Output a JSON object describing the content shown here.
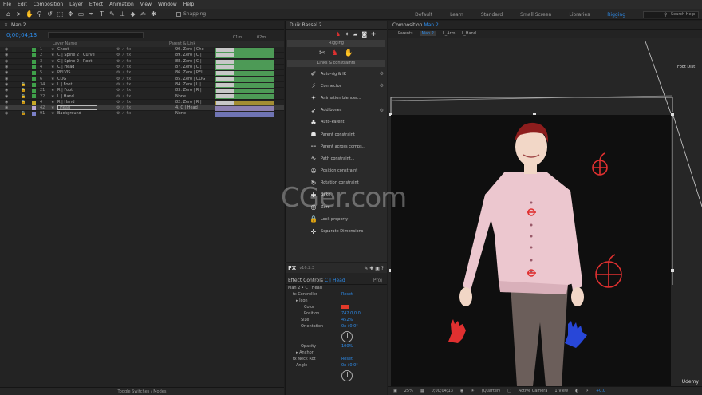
{
  "menu": [
    "File",
    "Edit",
    "Composition",
    "Layer",
    "Effect",
    "Animation",
    "View",
    "Window",
    "Help"
  ],
  "toolbar": {
    "snapping_label": "Snapping",
    "workspaces": [
      "Default",
      "Learn",
      "Standard",
      "Small Screen",
      "Libraries",
      "Rigging"
    ],
    "active_workspace": "Rigging",
    "search_placeholder": "Search Help"
  },
  "timeline": {
    "tab_label": "Man 2",
    "timecode": "0;00;04;13",
    "col_layer_name": "Layer Name",
    "col_parent": "Parent & Link",
    "ruler_labels": [
      "01m",
      "02m"
    ],
    "footer_label": "Toggle Switches / Modes",
    "layers": [
      {
        "num": "1",
        "name": "Chest",
        "parent": "90. Zero | Che",
        "color": "#3fa04a",
        "locked": false
      },
      {
        "num": "2",
        "name": "C | Spine 2 | Curve",
        "parent": "89. Zero | C | ",
        "color": "#3fa04a",
        "locked": false
      },
      {
        "num": "3",
        "name": "C | Spine 2 | Root",
        "parent": "88. Zero | C | ",
        "color": "#3fa04a",
        "locked": false
      },
      {
        "num": "4",
        "name": "C | Head",
        "parent": "87. Zero | C | ",
        "color": "#3fa04a",
        "locked": false
      },
      {
        "num": "5",
        "name": "PELVIS",
        "parent": "86. Zero | PEL",
        "color": "#3fa04a",
        "locked": false
      },
      {
        "num": "6",
        "name": "COG",
        "parent": "85. Zero | COG",
        "color": "#3fa04a",
        "locked": false
      },
      {
        "num": "34",
        "name": "L | Foot",
        "parent": "84. Zero | L | ",
        "color": "#3fa04a",
        "locked": true
      },
      {
        "num": "21",
        "name": "R | Foot",
        "parent": "83. Zero | R | ",
        "color": "#3fa04a",
        "locked": true
      },
      {
        "num": "22",
        "name": "L | Hand",
        "parent": "None",
        "color": "#3fa04a",
        "locked": true
      },
      {
        "num": "4",
        "name": "R | Hand",
        "parent": "82. Zero | R | ",
        "color": "#c7a928",
        "locked": true
      },
      {
        "num": "42",
        "name": "Head",
        "parent": "4. C | Head",
        "color": "#b8a7d4",
        "locked": false
      },
      {
        "num": "91",
        "name": "Background",
        "parent": "None",
        "color": "#7b80c8",
        "locked": true
      }
    ]
  },
  "duik": {
    "tab_label": "Duik Bassel.2",
    "section_rigging": "Rigging",
    "section_links": "Links & constraints",
    "items": [
      {
        "icon": "✐",
        "label": "Auto-rig & IK",
        "gear": true,
        "name": "auto-rig-ik"
      },
      {
        "icon": "⚡",
        "label": "Connector",
        "gear": true,
        "name": "connector"
      },
      {
        "icon": "✦",
        "label": "Animation blender...",
        "gear": false,
        "name": "animation-blender"
      },
      {
        "icon": "➶",
        "label": "Add bones",
        "gear": true,
        "name": "add-bones"
      },
      {
        "icon": "♣",
        "label": "Auto-Parent",
        "gear": false,
        "name": "auto-parent"
      },
      {
        "icon": "☗",
        "label": "Parent constraint",
        "gear": false,
        "name": "parent-constraint"
      },
      {
        "icon": "☷",
        "label": "Parent across comps...",
        "gear": false,
        "name": "parent-across-comps"
      },
      {
        "icon": "∿",
        "label": "Path constraint...",
        "gear": false,
        "name": "path-constraint"
      },
      {
        "icon": "✇",
        "label": "Position constraint",
        "gear": false,
        "name": "position-constraint"
      },
      {
        "icon": "↻",
        "label": "Rotation constraint",
        "gear": false,
        "name": "rotation-constraint"
      },
      {
        "icon": "✚",
        "label": "Bake",
        "gear": false,
        "name": "bake"
      },
      {
        "icon": "◎",
        "label": "Zero",
        "gear": false,
        "name": "zero"
      },
      {
        "icon": "🔒",
        "label": "Lock property",
        "gear": false,
        "name": "lock-property"
      },
      {
        "icon": "✜",
        "label": "Separate Dimensions",
        "gear": false,
        "name": "separate-dimensions"
      }
    ]
  },
  "effects": {
    "version": "v16.2.3",
    "tab_label": "Effect Controls",
    "tab_layer": "C | Head",
    "second_tab": "Proj",
    "breadcrumb": "Man 2 • C | Head",
    "rows": [
      {
        "indent": 6,
        "label": "Controller",
        "reset": "Reset",
        "kind": "fx"
      },
      {
        "indent": 10,
        "label": "Icon",
        "kind": "group"
      },
      {
        "indent": 20,
        "label": "Color",
        "kind": "color"
      },
      {
        "indent": 20,
        "label": "Position",
        "value": "742.0,0.0",
        "kind": "value"
      },
      {
        "indent": 16,
        "label": "Size",
        "value": "452%",
        "kind": "value"
      },
      {
        "indent": 16,
        "label": "Orientation",
        "value": "0x+0.0°",
        "kind": "value"
      },
      {
        "indent": 0,
        "label": "",
        "kind": "knob"
      },
      {
        "indent": 16,
        "label": "Opacity",
        "value": "100%",
        "kind": "value"
      },
      {
        "indent": 10,
        "label": "Anchor",
        "kind": "group"
      },
      {
        "indent": 6,
        "label": "Neck Rot",
        "reset": "Reset",
        "kind": "fx"
      },
      {
        "indent": 10,
        "label": "Angle",
        "value": "0x+0.0°",
        "kind": "value"
      },
      {
        "indent": 0,
        "label": "",
        "kind": "knob"
      }
    ]
  },
  "comp": {
    "tab_prefix": "Composition",
    "tab_name": "Man 2",
    "crumbs": [
      "Man 2",
      "L_Arm",
      "L_Hand"
    ],
    "crumbs_label": "Parents",
    "foot_label": "Foot Dist",
    "footer": {
      "zoom": "25%",
      "timecode": "0;00;04;13",
      "resolution": "(Quarter)",
      "camera": "Active Camera",
      "views": "1 View",
      "exposure": "+0.0"
    }
  },
  "overlay": {
    "watermark": "CGer.com",
    "udemy": "Udemy"
  }
}
